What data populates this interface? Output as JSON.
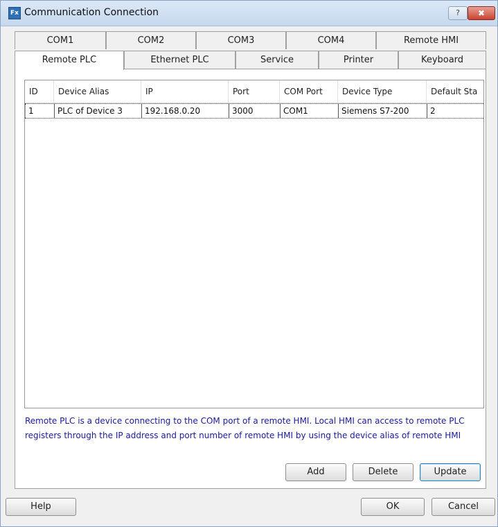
{
  "window": {
    "title": "Communication Connection"
  },
  "title_buttons": {
    "help": "?",
    "close": "✖"
  },
  "tabs_row1": [
    "COM1",
    "COM2",
    "COM3",
    "COM4",
    "Remote HMI"
  ],
  "tabs_row2": [
    "Remote PLC",
    "Ethernet PLC",
    "Service",
    "Printer",
    "Keyboard"
  ],
  "active_tab": "Remote PLC",
  "table": {
    "columns": [
      "ID",
      "Device Alias",
      "IP",
      "Port",
      "COM Port",
      "Device Type",
      "Default Sta"
    ],
    "rows": [
      [
        "1",
        "PLC of Device 3",
        "192.168.0.20",
        "3000",
        "COM1",
        "Siemens S7-200",
        "2"
      ]
    ]
  },
  "description": "Remote PLC is a device connecting to the COM port of a remote HMI. Local HMI can access to remote PLC registers through the IP address and port number of remote HMI by using the device alias of remote HMI",
  "buttons": {
    "add": "Add",
    "delete": "Delete",
    "update": "Update",
    "help": "Help",
    "ok": "OK",
    "cancel": "Cancel"
  },
  "colors": {
    "description_text": "#1a1aa0",
    "title_bar": "#c6d8ee",
    "close_button": "#c9432f"
  }
}
